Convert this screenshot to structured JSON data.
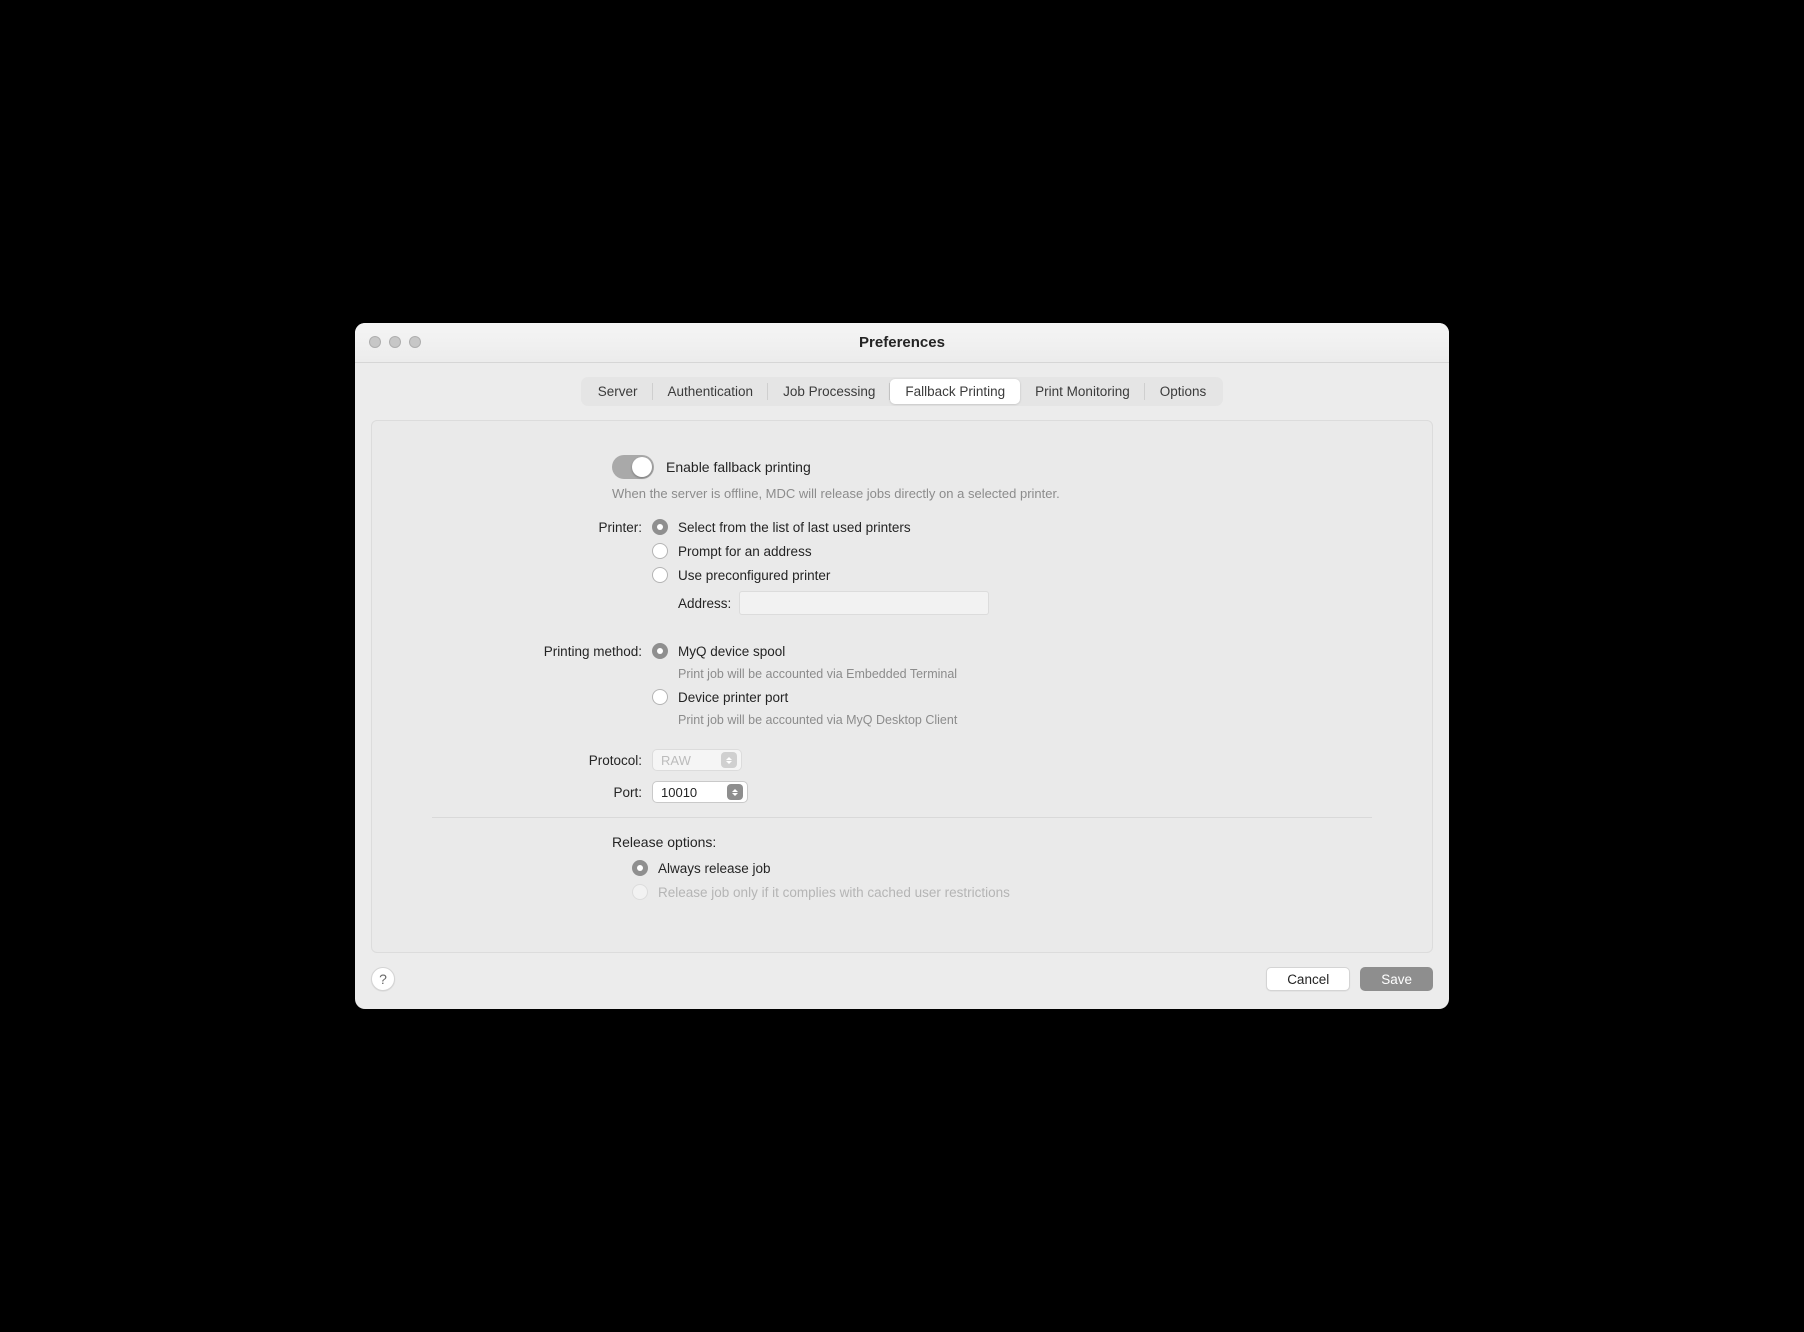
{
  "window": {
    "title": "Preferences"
  },
  "tabs": {
    "server": "Server",
    "authentication": "Authentication",
    "job_processing": "Job Processing",
    "fallback_printing": "Fallback Printing",
    "print_monitoring": "Print Monitoring",
    "options": "Options"
  },
  "fallback": {
    "toggle_label": "Enable fallback printing",
    "hint": "When the server is offline, MDC will release jobs directly on a selected printer.",
    "printer_label": "Printer:",
    "printer_options": {
      "last_used": "Select from the list of last used printers",
      "prompt": "Prompt for an address",
      "preconfigured": "Use preconfigured printer"
    },
    "address_label": "Address:",
    "address_value": "",
    "method_label": "Printing method:",
    "methods": {
      "myq": "MyQ device spool",
      "myq_hint": "Print job will be accounted via Embedded Terminal",
      "device_port": "Device printer port",
      "device_port_hint": "Print job will be accounted via MyQ Desktop Client"
    },
    "protocol_label": "Protocol:",
    "protocol_value": "RAW",
    "port_label": "Port:",
    "port_value": "10010",
    "release_label": "Release options:",
    "release_options": {
      "always": "Always release job",
      "compliant": "Release job only if it complies with cached user restrictions"
    }
  },
  "footer": {
    "cancel": "Cancel",
    "save": "Save"
  }
}
